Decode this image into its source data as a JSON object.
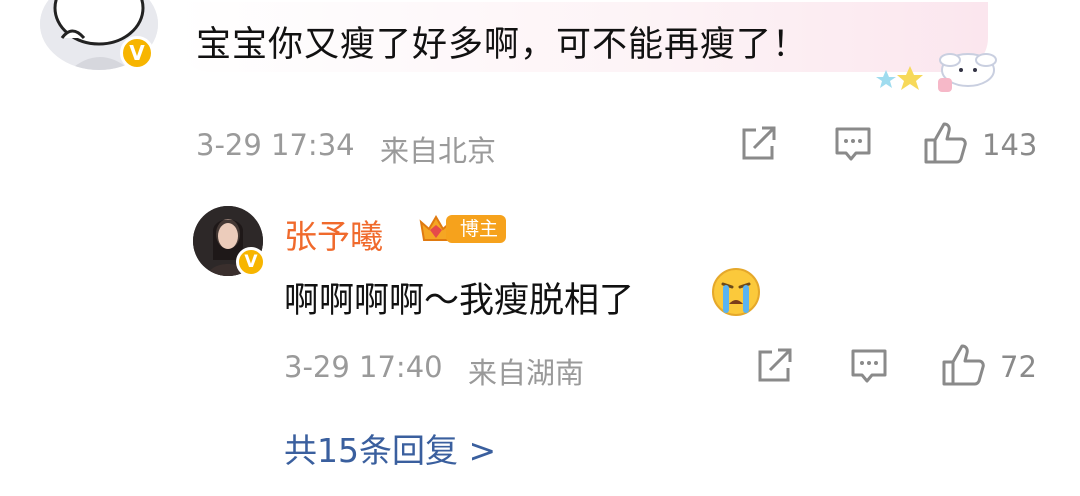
{
  "comment": {
    "text": "宝宝你又瘦了好多啊，可不能再瘦了！",
    "time": "3-29 17:34",
    "location": "来自北京",
    "like_count": "143",
    "verify_badge": "V"
  },
  "reply": {
    "author": "张予曦",
    "badge_label": "博主",
    "text": "啊啊啊啊～我瘦脱相了",
    "emoji": "crying-face-icon",
    "time": "3-29 17:40",
    "location": "来自湖南",
    "like_count": "72",
    "verify_badge": "V"
  },
  "more_replies": "共15条回复 >",
  "colors": {
    "author_name": "#f06a2c",
    "link": "#3a5f9e",
    "meta_gray": "#9a9a9a",
    "verify_gold": "#f7b500",
    "badge_orange": "#f6a21c"
  }
}
